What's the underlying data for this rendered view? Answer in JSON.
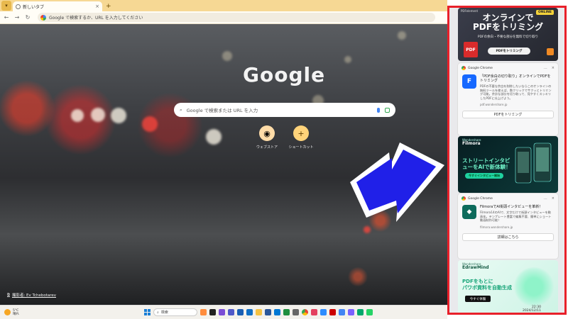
{
  "browser": {
    "tab_title": "新しいタブ",
    "tab_close": "×",
    "new_tab": "+",
    "omnibox_text": "Google で検索するか、URL を入力してください"
  },
  "newtab": {
    "logo": "Google",
    "search_placeholder": "Google で検索または URL を入力",
    "shortcuts": [
      {
        "label": "ウェブストア",
        "icon": "chrome-webstore-icon"
      },
      {
        "label": "ショートカット",
        "icon": "add-shortcut-icon",
        "glyph": "+"
      }
    ],
    "photo_credit": "撮影者: Ev Tchebotarev"
  },
  "ads": {
    "ad1": {
      "brand": "PDFelement",
      "badge": "ONLINE",
      "headline_line1": "オンラインで",
      "headline_line2": "PDFをトリミング",
      "subtitle": "PDFの余白・不要な部分を無料で切り取り",
      "cta": "PDFをトリミング",
      "pdf_label": "PDF"
    },
    "notif1": {
      "source": "Google Chrome",
      "title": "「PDF余白の切り取り」オンラインでPDFをトリミング",
      "description": "PDFの不要な余白を削除したいならこのオンラインの無料ツールを使えば、数クリックでサクッとトリミング可能。余計な部分を切り取って、見やすくスッキリしたPDFに仕上げよう。",
      "site": "pdf.wondershare.jp",
      "button": "PDFをトリミング"
    },
    "ad2": {
      "brand_small": "Wondershare",
      "brand": "Filmora",
      "headline": "ストリートインタビューをAIで新体験！",
      "cta": "今すぐインタビュー開始"
    },
    "notif2": {
      "source": "Google Chrome",
      "title": "FilmoraでAI街頭インタビューを革新！",
      "description": "Filmora14のAIで、文字だけで街頭インタビューを動画化。テンプレート豊富で編集不要、簡単にショート動画制作可能！",
      "site": "filmora.wondershare.jp",
      "button": "詳細はこちら"
    },
    "ad3": {
      "brand_small": "Wondershare",
      "brand": "EdrawMind",
      "headline_line1": "PDFをもとに",
      "headline_line2": "パワポ資料を自動生成",
      "cta": "今すぐ体験"
    }
  },
  "taskbar": {
    "weather_temp": "5°C",
    "weather_desc": "晴れ",
    "search_placeholder": "検索",
    "time": "22:30",
    "date": "2024/12/11"
  },
  "colors": {
    "highlight_border": "#e8202a",
    "arrow_fill": "#2020e8",
    "tabbar": "#f6d894"
  }
}
